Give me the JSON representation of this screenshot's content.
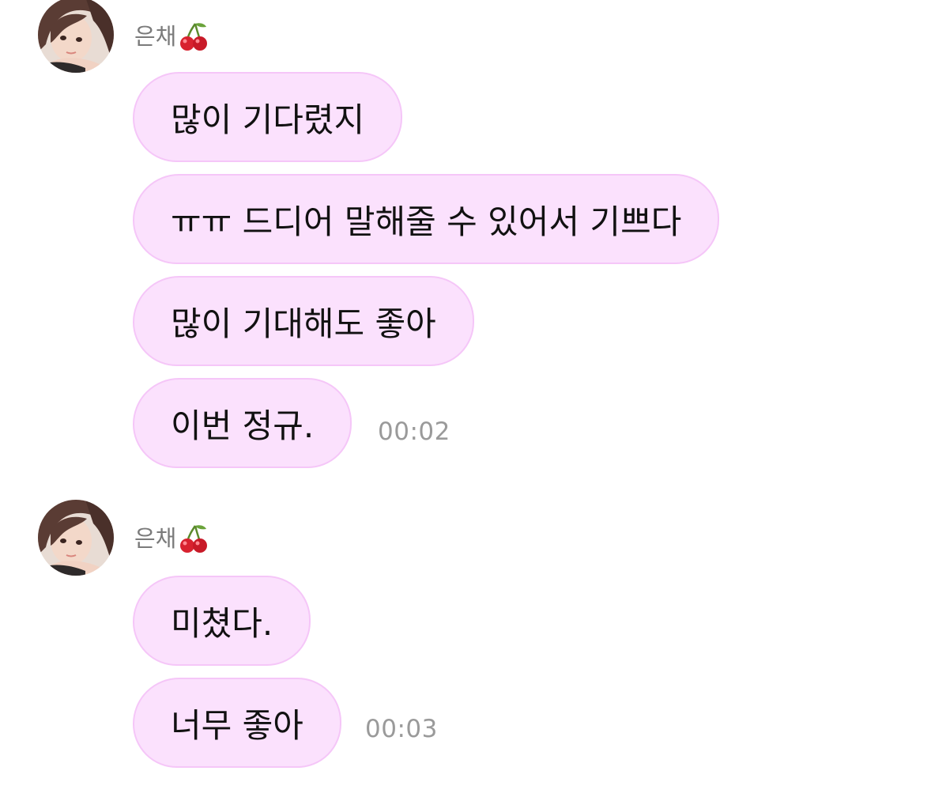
{
  "chat": {
    "groups": [
      {
        "sender": "은채",
        "sender_emoji": "cherry",
        "messages": [
          "많이 기다렸지",
          "ㅠㅠ 드디어 말해줄 수 있어서 기쁘다",
          "많이 기대해도 좋아",
          "이번 정규."
        ],
        "time": "00:02"
      },
      {
        "sender": "은채",
        "sender_emoji": "cherry",
        "messages": [
          "미쳤다.",
          "너무 좋아"
        ],
        "time": "00:03"
      }
    ]
  },
  "colors": {
    "bubble_fill": "#fbe1fd",
    "bubble_border": "#f5c6f8",
    "time_text": "#9a9a9a",
    "sender_text": "#7b7b7b"
  }
}
